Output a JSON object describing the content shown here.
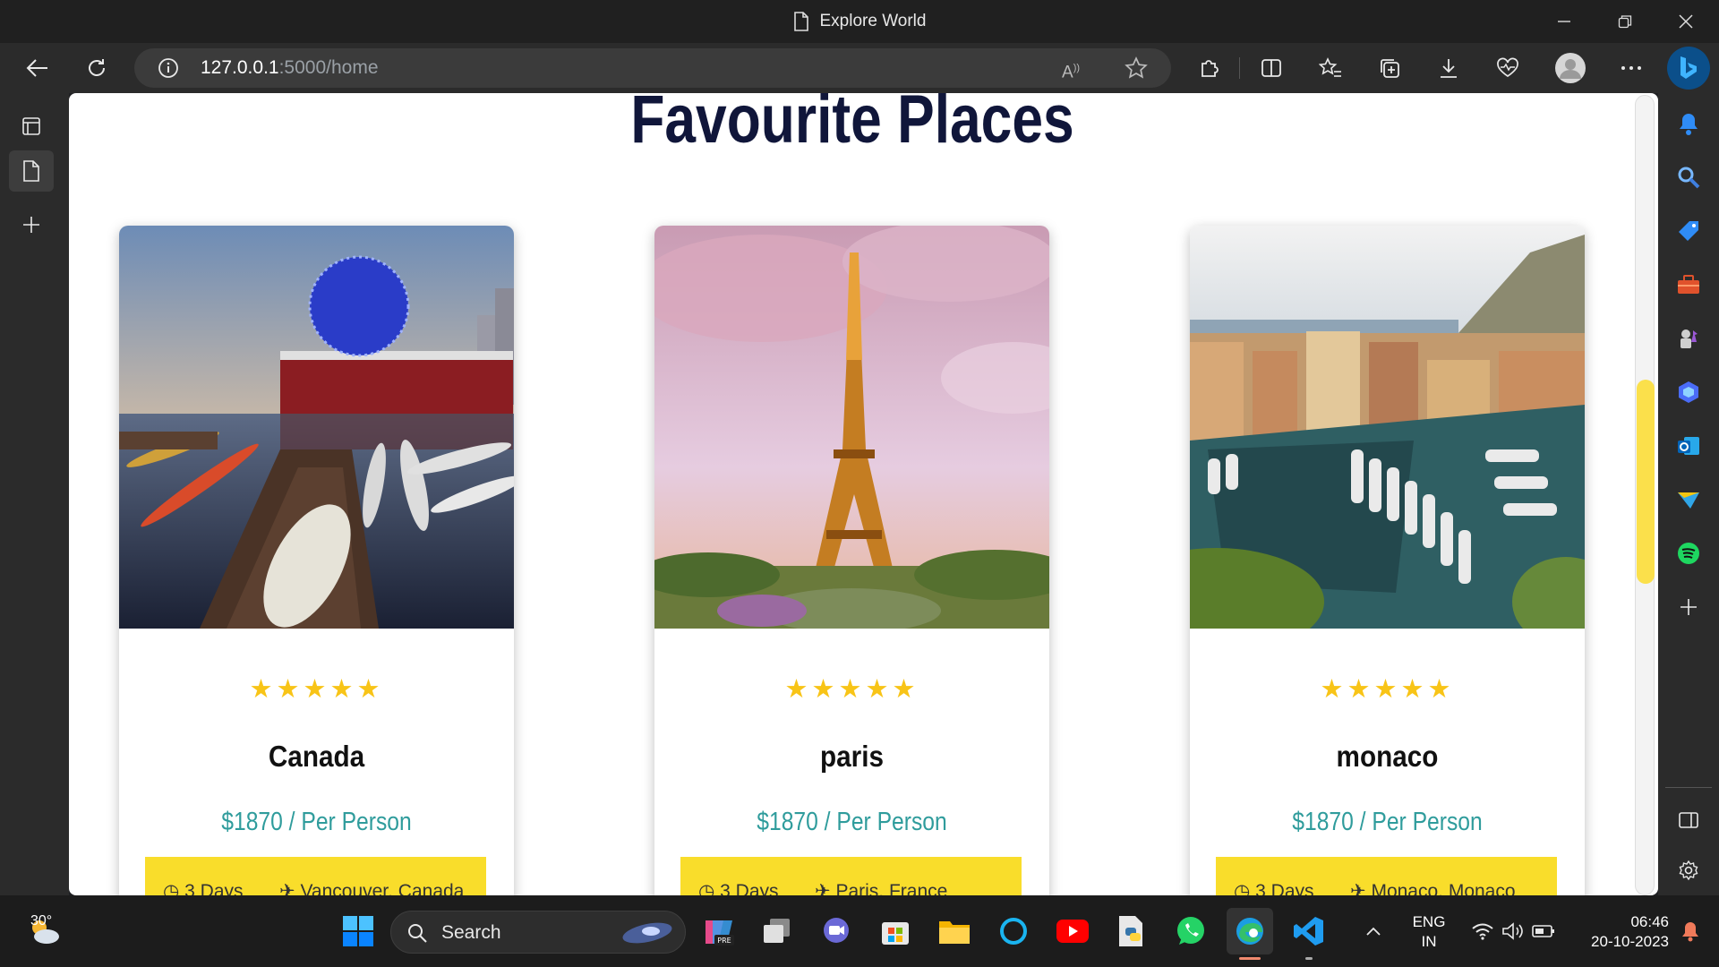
{
  "window": {
    "title": "Explore World"
  },
  "browser": {
    "url_host": "127.0.0.1",
    "url_path": ":5000/home"
  },
  "page": {
    "title": "Favourite Places",
    "stars": "★★★★★",
    "cards": [
      {
        "name": "Canada",
        "price": "$1870 / Per Person",
        "days": "3 Days",
        "location": "Vancouver, Canada"
      },
      {
        "name": "paris",
        "price": "$1870 / Per Person",
        "days": "3 Days",
        "location": "Paris, France"
      },
      {
        "name": "monaco",
        "price": "$1870 / Per Person",
        "days": "3 Days",
        "location": "Monaco, Monaco"
      }
    ]
  },
  "taskbar": {
    "weather_temp": "30°",
    "search_label": "Search",
    "lang_top": "ENG",
    "lang_bottom": "IN",
    "time": "06:46",
    "date": "20-10-2023"
  },
  "colors": {
    "accent": "#f9dd2b",
    "price": "#2f9c9c",
    "title": "#10163a"
  }
}
